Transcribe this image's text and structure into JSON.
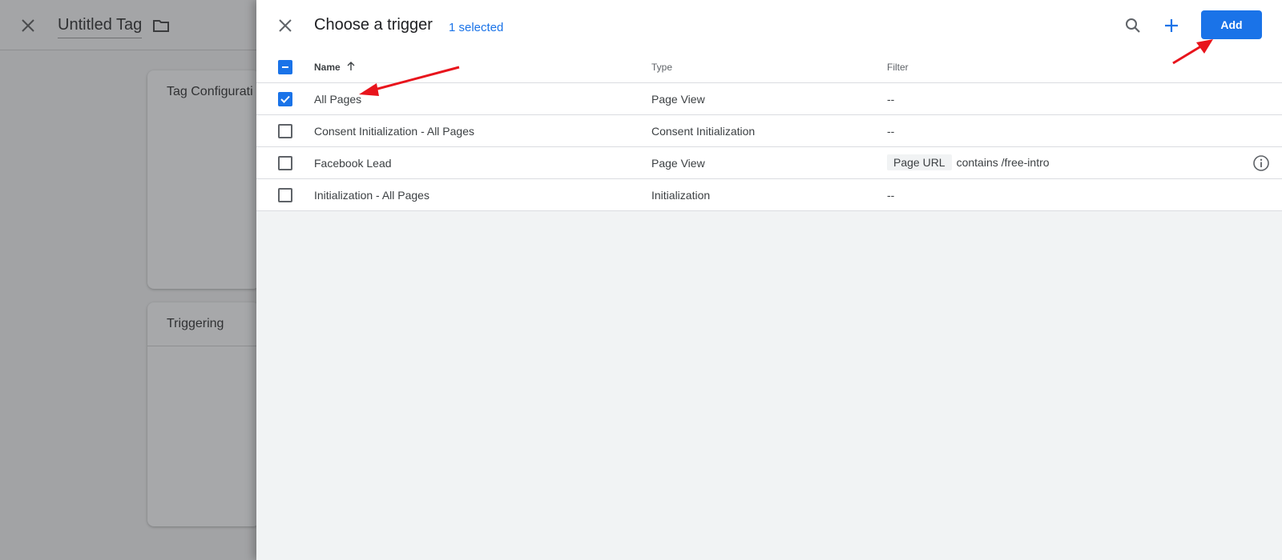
{
  "background": {
    "tag_title": "Untitled Tag",
    "card_config_title": "Tag Configurati",
    "card_trigger_title": "Triggering"
  },
  "panel": {
    "title": "Choose a trigger",
    "selected_count": "1 selected",
    "add_label": "Add",
    "columns": {
      "name": "Name",
      "type": "Type",
      "filter": "Filter"
    },
    "rows": [
      {
        "name": "All Pages",
        "type": "Page View",
        "filter": "--",
        "checked": true
      },
      {
        "name": "Consent Initialization - All Pages",
        "type": "Consent Initialization",
        "filter": "--",
        "checked": false
      },
      {
        "name": "Facebook Lead",
        "type": "Page View",
        "filter_chip": "Page URL",
        "filter_text": "contains /free-intro",
        "checked": false
      },
      {
        "name": "Initialization - All Pages",
        "type": "Initialization",
        "filter": "--",
        "checked": false
      }
    ]
  },
  "colors": {
    "accent": "#1a73e8",
    "annotation": "#e8141c"
  },
  "icons": [
    "close-icon",
    "folder-icon",
    "search-icon",
    "plus-icon",
    "sort-arrow-up-icon",
    "info-icon"
  ]
}
